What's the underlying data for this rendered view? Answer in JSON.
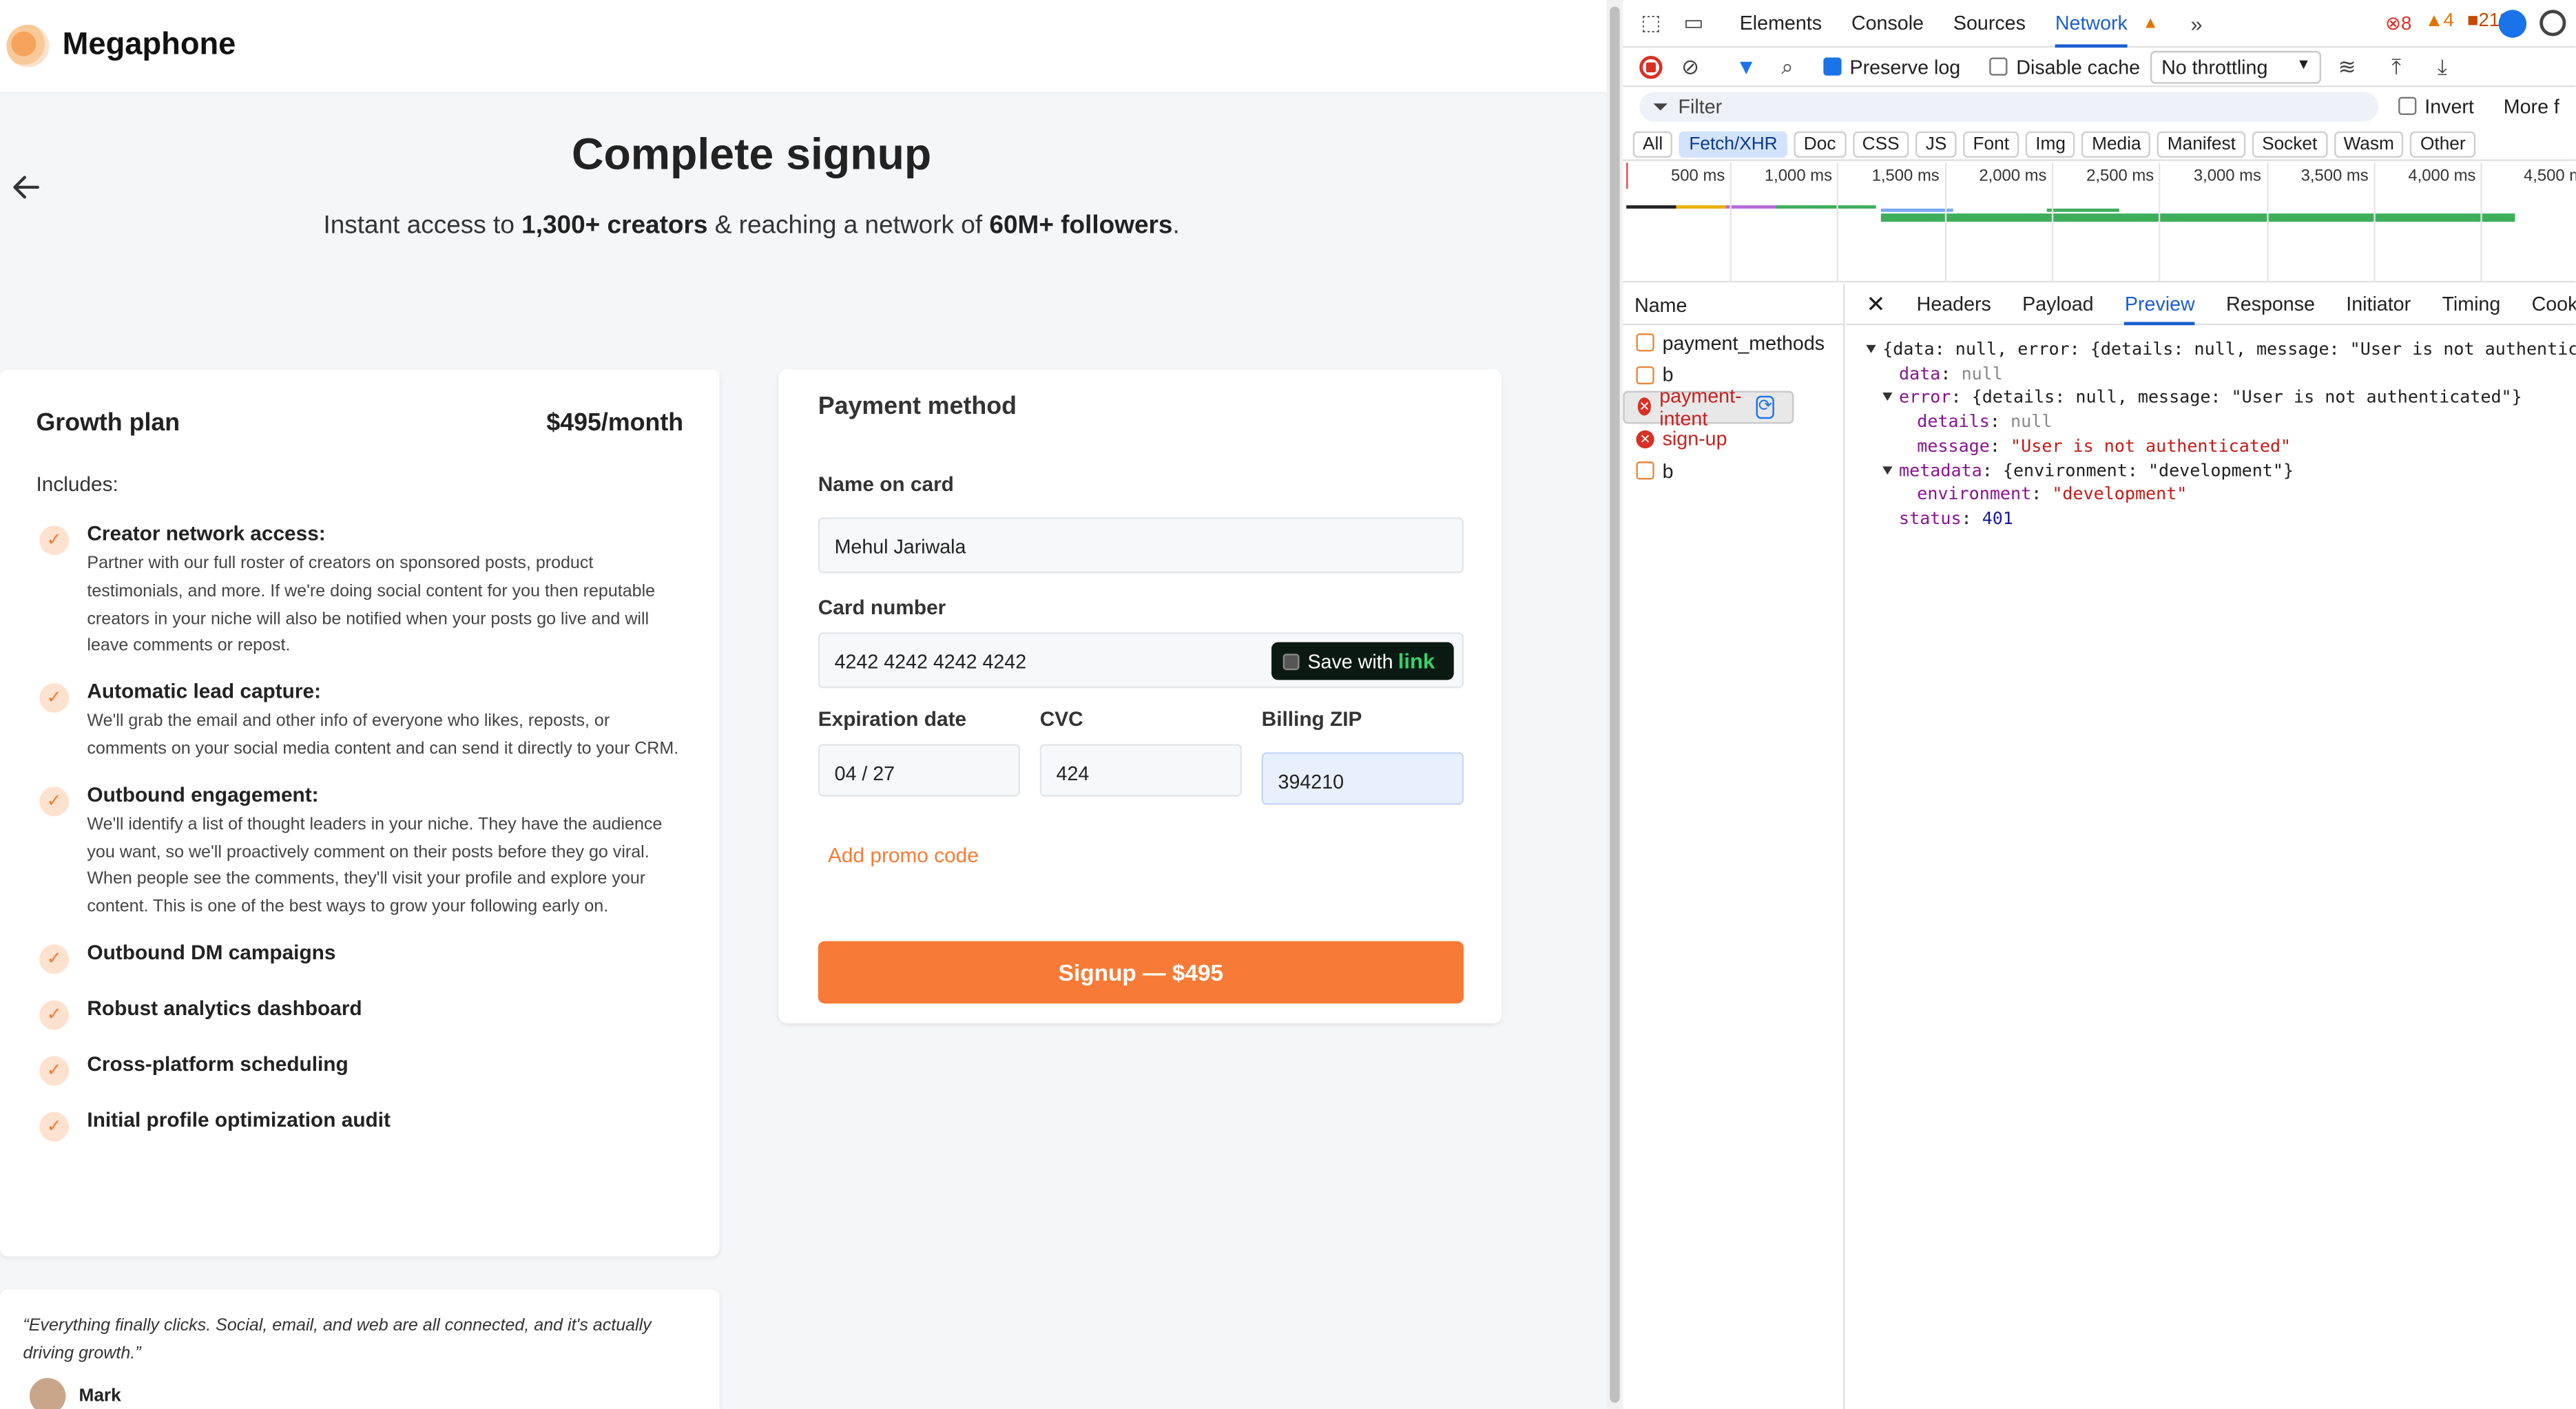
{
  "app": {
    "brand": "Megaphone"
  },
  "header": {
    "title": "Complete signup",
    "subtitle_pre": "Instant access to ",
    "subtitle_b1": "1,300+ creators",
    "subtitle_mid": " & reaching a network of ",
    "subtitle_b2": "60M+ followers",
    "subtitle_post": "."
  },
  "plan": {
    "name": "Growth plan",
    "price": "$495/month",
    "includes": "Includes:",
    "features": [
      {
        "title": "Creator network access:",
        "desc": "Partner with our full roster of creators on sponsored posts, product testimonials, and more. If we're doing social content for you then reputable creators in your niche will also be notified when your posts go live and will leave comments or repost."
      },
      {
        "title": "Automatic lead capture:",
        "desc": "We'll grab the email and other info of everyone who likes, reposts, or comments on your social media content and can send it directly to your CRM."
      },
      {
        "title": "Outbound engagement:",
        "desc": "We'll identify a list of thought leaders in your niche. They have the audience you want, so we'll proactively comment on their posts before they go viral. When people see the comments, they'll visit your profile and explore your content. This is one of the best ways to grow your following early on."
      },
      {
        "title": "Outbound DM campaigns",
        "desc": ""
      },
      {
        "title": "Robust analytics dashboard",
        "desc": ""
      },
      {
        "title": "Cross-platform scheduling",
        "desc": ""
      },
      {
        "title": "Initial profile optimization audit",
        "desc": ""
      }
    ]
  },
  "payment": {
    "title": "Payment method",
    "name_label": "Name on card",
    "name_value": "Mehul Jariwala",
    "card_label": "Card number",
    "card_value": "4242 4242 4242 4242",
    "link_save": "Save with",
    "link_word": "link",
    "exp_label": "Expiration date",
    "exp_value": "04 / 27",
    "cvc_label": "CVC",
    "cvc_value": "424",
    "zip_label": "Billing ZIP",
    "zip_value": "394210",
    "promo": "Add promo code",
    "submit": "Signup — $495"
  },
  "testimonial": {
    "quote": "“Everything finally clicks. Social, email, and web are all connected, and it's actually driving growth.”",
    "author": "Mark"
  },
  "devtools": {
    "tabs": [
      "Elements",
      "Console",
      "Sources",
      "Network"
    ],
    "active_tab": "Network",
    "errors": "8",
    "warnings": "4",
    "issues": "213",
    "preserve_log": "Preserve log",
    "disable_cache": "Disable cache",
    "throttling": "No throttling",
    "filter_placeholder": "Filter",
    "invert": "Invert",
    "more": "More f",
    "type_chips": [
      "All",
      "Fetch/XHR",
      "Doc",
      "CSS",
      "JS",
      "Font",
      "Img",
      "Media",
      "Manifest",
      "Socket",
      "Wasm",
      "Other"
    ],
    "active_chip": "Fetch/XHR",
    "ticks": [
      "500 ms",
      "1,000 ms",
      "1,500 ms",
      "2,000 ms",
      "2,500 ms",
      "3,000 ms",
      "3,500 ms",
      "4,000 ms",
      "4,500 m"
    ],
    "name_header": "Name",
    "requests": [
      {
        "name": "payment_methods",
        "status": "ok"
      },
      {
        "name": "b",
        "status": "ok"
      },
      {
        "name": "payment-intent",
        "status": "error"
      },
      {
        "name": "sign-up",
        "status": "error"
      },
      {
        "name": "b",
        "status": "ok"
      }
    ],
    "detail_tabs": [
      "Headers",
      "Payload",
      "Preview",
      "Response",
      "Initiator",
      "Timing",
      "Cooki"
    ],
    "active_detail": "Preview",
    "preview": {
      "l1": "{data: null, error: {details: null, message: \"User is not authenticat",
      "data_key": "data",
      "data_val": "null",
      "error_key": "error",
      "error_summary": "{details: null, message: \"User is not authenticated\"}",
      "details_key": "details",
      "details_val": "null",
      "message_key": "message",
      "message_val": "\"User is not authenticated\"",
      "metadata_key": "metadata",
      "metadata_summary": "{environment: \"development\"}",
      "env_key": "environment",
      "env_val": "\"development\"",
      "status_key": "status",
      "status_val": "401"
    }
  }
}
